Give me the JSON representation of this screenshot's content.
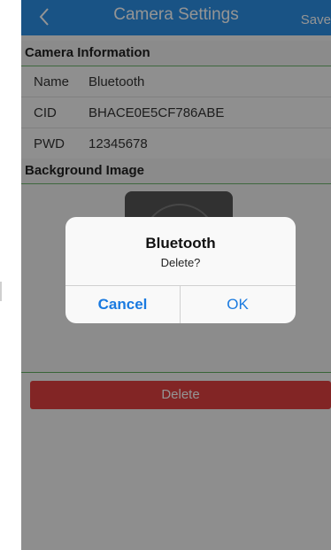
{
  "nav": {
    "title": "Camera Settings",
    "save_label": "Save"
  },
  "camera_info": {
    "header": "Camera Information",
    "rows": [
      {
        "label": "Name",
        "value": "Bluetooth"
      },
      {
        "label": "CID",
        "value": "BHACE0E5CF786ABE"
      },
      {
        "label": "PWD",
        "value": "12345678"
      }
    ]
  },
  "background": {
    "header": "Background Image"
  },
  "delete_label": "Delete",
  "dialog": {
    "title": "Bluetooth",
    "message": "Delete?",
    "cancel_label": "Cancel",
    "ok_label": "OK"
  },
  "colors": {
    "nav": "#2b8fe6",
    "delete": "#e04040",
    "dialog_button": "#1a7ae0",
    "section_rule": "#6db36d"
  }
}
